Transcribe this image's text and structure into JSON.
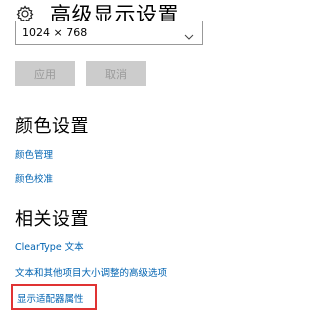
{
  "header": {
    "title": "高级显示设置",
    "icon": "gear-icon"
  },
  "resolution": {
    "selected": "1024 × 768"
  },
  "buttons": {
    "apply": "应用",
    "cancel": "取消"
  },
  "color_settings": {
    "heading": "颜色设置",
    "links": [
      "颜色管理",
      "颜色校准"
    ]
  },
  "related_settings": {
    "heading": "相关设置",
    "links": [
      "ClearType 文本",
      "文本和其他项目大小调整的高级选项",
      "显示适配器属性"
    ]
  },
  "colors": {
    "link": "#0063b1",
    "highlight": "#e03333",
    "button_bg": "#cccccc"
  }
}
